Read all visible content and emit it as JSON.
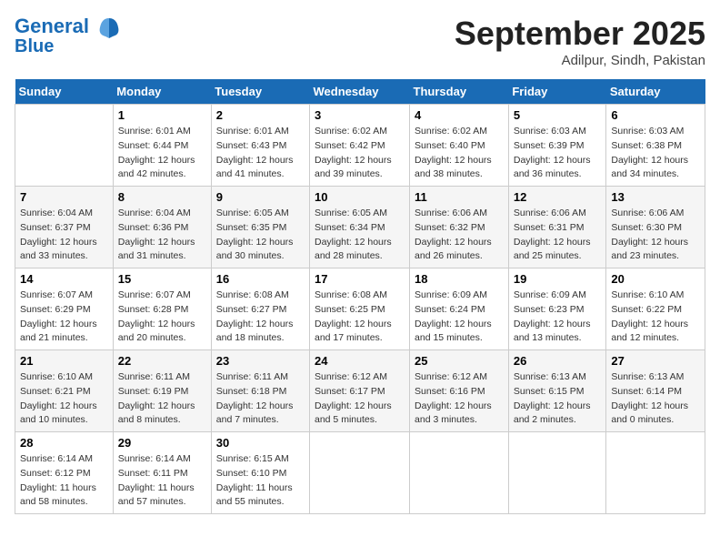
{
  "logo": {
    "line1": "General",
    "line2": "Blue"
  },
  "title": "September 2025",
  "location": "Adilpur, Sindh, Pakistan",
  "days_header": [
    "Sunday",
    "Monday",
    "Tuesday",
    "Wednesday",
    "Thursday",
    "Friday",
    "Saturday"
  ],
  "weeks": [
    [
      {
        "day": "",
        "info": ""
      },
      {
        "day": "1",
        "info": "Sunrise: 6:01 AM\nSunset: 6:44 PM\nDaylight: 12 hours\nand 42 minutes."
      },
      {
        "day": "2",
        "info": "Sunrise: 6:01 AM\nSunset: 6:43 PM\nDaylight: 12 hours\nand 41 minutes."
      },
      {
        "day": "3",
        "info": "Sunrise: 6:02 AM\nSunset: 6:42 PM\nDaylight: 12 hours\nand 39 minutes."
      },
      {
        "day": "4",
        "info": "Sunrise: 6:02 AM\nSunset: 6:40 PM\nDaylight: 12 hours\nand 38 minutes."
      },
      {
        "day": "5",
        "info": "Sunrise: 6:03 AM\nSunset: 6:39 PM\nDaylight: 12 hours\nand 36 minutes."
      },
      {
        "day": "6",
        "info": "Sunrise: 6:03 AM\nSunset: 6:38 PM\nDaylight: 12 hours\nand 34 minutes."
      }
    ],
    [
      {
        "day": "7",
        "info": "Sunrise: 6:04 AM\nSunset: 6:37 PM\nDaylight: 12 hours\nand 33 minutes."
      },
      {
        "day": "8",
        "info": "Sunrise: 6:04 AM\nSunset: 6:36 PM\nDaylight: 12 hours\nand 31 minutes."
      },
      {
        "day": "9",
        "info": "Sunrise: 6:05 AM\nSunset: 6:35 PM\nDaylight: 12 hours\nand 30 minutes."
      },
      {
        "day": "10",
        "info": "Sunrise: 6:05 AM\nSunset: 6:34 PM\nDaylight: 12 hours\nand 28 minutes."
      },
      {
        "day": "11",
        "info": "Sunrise: 6:06 AM\nSunset: 6:32 PM\nDaylight: 12 hours\nand 26 minutes."
      },
      {
        "day": "12",
        "info": "Sunrise: 6:06 AM\nSunset: 6:31 PM\nDaylight: 12 hours\nand 25 minutes."
      },
      {
        "day": "13",
        "info": "Sunrise: 6:06 AM\nSunset: 6:30 PM\nDaylight: 12 hours\nand 23 minutes."
      }
    ],
    [
      {
        "day": "14",
        "info": "Sunrise: 6:07 AM\nSunset: 6:29 PM\nDaylight: 12 hours\nand 21 minutes."
      },
      {
        "day": "15",
        "info": "Sunrise: 6:07 AM\nSunset: 6:28 PM\nDaylight: 12 hours\nand 20 minutes."
      },
      {
        "day": "16",
        "info": "Sunrise: 6:08 AM\nSunset: 6:27 PM\nDaylight: 12 hours\nand 18 minutes."
      },
      {
        "day": "17",
        "info": "Sunrise: 6:08 AM\nSunset: 6:25 PM\nDaylight: 12 hours\nand 17 minutes."
      },
      {
        "day": "18",
        "info": "Sunrise: 6:09 AM\nSunset: 6:24 PM\nDaylight: 12 hours\nand 15 minutes."
      },
      {
        "day": "19",
        "info": "Sunrise: 6:09 AM\nSunset: 6:23 PM\nDaylight: 12 hours\nand 13 minutes."
      },
      {
        "day": "20",
        "info": "Sunrise: 6:10 AM\nSunset: 6:22 PM\nDaylight: 12 hours\nand 12 minutes."
      }
    ],
    [
      {
        "day": "21",
        "info": "Sunrise: 6:10 AM\nSunset: 6:21 PM\nDaylight: 12 hours\nand 10 minutes."
      },
      {
        "day": "22",
        "info": "Sunrise: 6:11 AM\nSunset: 6:19 PM\nDaylight: 12 hours\nand 8 minutes."
      },
      {
        "day": "23",
        "info": "Sunrise: 6:11 AM\nSunset: 6:18 PM\nDaylight: 12 hours\nand 7 minutes."
      },
      {
        "day": "24",
        "info": "Sunrise: 6:12 AM\nSunset: 6:17 PM\nDaylight: 12 hours\nand 5 minutes."
      },
      {
        "day": "25",
        "info": "Sunrise: 6:12 AM\nSunset: 6:16 PM\nDaylight: 12 hours\nand 3 minutes."
      },
      {
        "day": "26",
        "info": "Sunrise: 6:13 AM\nSunset: 6:15 PM\nDaylight: 12 hours\nand 2 minutes."
      },
      {
        "day": "27",
        "info": "Sunrise: 6:13 AM\nSunset: 6:14 PM\nDaylight: 12 hours\nand 0 minutes."
      }
    ],
    [
      {
        "day": "28",
        "info": "Sunrise: 6:14 AM\nSunset: 6:12 PM\nDaylight: 11 hours\nand 58 minutes."
      },
      {
        "day": "29",
        "info": "Sunrise: 6:14 AM\nSunset: 6:11 PM\nDaylight: 11 hours\nand 57 minutes."
      },
      {
        "day": "30",
        "info": "Sunrise: 6:15 AM\nSunset: 6:10 PM\nDaylight: 11 hours\nand 55 minutes."
      },
      {
        "day": "",
        "info": ""
      },
      {
        "day": "",
        "info": ""
      },
      {
        "day": "",
        "info": ""
      },
      {
        "day": "",
        "info": ""
      }
    ]
  ]
}
